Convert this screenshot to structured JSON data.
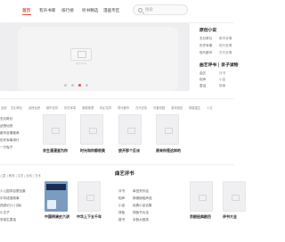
{
  "nav": {
    "items": [
      {
        "label": "首页",
        "active": true
      },
      {
        "label": "有声书库"
      },
      {
        "label": "排行榜"
      },
      {
        "label": "听书精选"
      },
      {
        "label": "漫画专区"
      }
    ],
    "search_placeholder": "搜索"
  },
  "banner": {
    "logo_text": "懒人听书",
    "slide_count": 4,
    "active_slide": 2
  },
  "side_panel": {
    "section1_title": "原创小说",
    "section1_lines": [
      {
        "left": "玄幻奇幻",
        "right": "都市言情"
      },
      {
        "left": "历史军事",
        "right": "现代言情"
      },
      {
        "left": "现代都市",
        "right": "古代言情"
      }
    ],
    "section2_title": "曲艺评书 | 亲子读物",
    "section2_lines": [
      {
        "left": "曲艺",
        "right": "评书"
      },
      {
        "left": "相声",
        "right": "小品"
      },
      {
        "left": "童话",
        "right": "故事"
      }
    ]
  },
  "categories": [
    "全部",
    "玄幻奇幻",
    "武侠仙侠",
    "都市言情",
    "历史军事",
    "悬疑推理",
    "科幻灵异",
    "现代都市",
    "古代言情",
    "青春校园",
    "游戏竞技",
    "穿越重生",
    "人文"
  ],
  "left_list": [
    "玄幻奇幻",
    "武侠仙侠",
    "都市言情推荐",
    "历史军事排行",
    "一只兔子"
  ],
  "books_row1": [
    {
      "title": "余生漫漫皆为你"
    },
    {
      "title": "时光和你都很美"
    },
    {
      "title": "放开那个反派"
    },
    {
      "title": "原来你是这样的"
    }
  ],
  "section2": {
    "tabs": "儿童 | 教育 | 文学 | 社科 | 艺术",
    "list": [
      "少儿国学启蒙全集",
      "中华成语故事",
      "西游记(少儿版)",
      "小王子",
      "安徒生童话"
    ],
    "books": [
      {
        "title": "中国明清史六讲"
      },
      {
        "title": "中华上下五千年"
      }
    ]
  },
  "quyi": {
    "title": "曲艺评书",
    "lines": [
      {
        "left": "评书",
        "right": "单田芳作品"
      },
      {
        "left": "相声",
        "right": "郭德纲相声选"
      },
      {
        "left": "小品",
        "right": "经典小品合集"
      },
      {
        "left": "快板",
        "right": "快板书大全"
      },
      {
        "left": "鼓书",
        "right": "京韵大鼓选"
      }
    ],
    "books": [
      {
        "title": "京剧经典剧目"
      },
      {
        "title": "评书大全"
      }
    ]
  }
}
